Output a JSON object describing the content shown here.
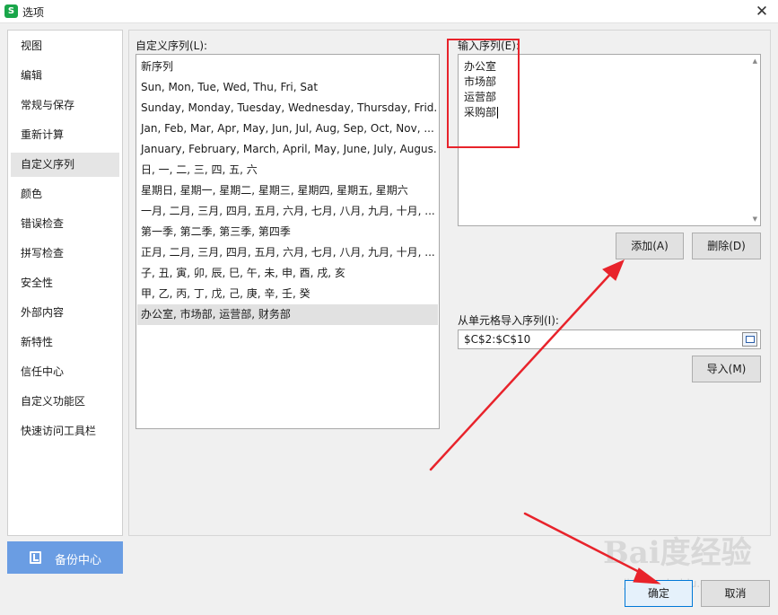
{
  "window": {
    "title": "选项",
    "app_icon_letter": "S"
  },
  "nav": {
    "items": [
      {
        "label": "视图",
        "active": false
      },
      {
        "label": "编辑",
        "active": false
      },
      {
        "label": "常规与保存",
        "active": false
      },
      {
        "label": "重新计算",
        "active": false
      },
      {
        "label": "自定义序列",
        "active": true
      },
      {
        "label": "颜色",
        "active": false
      },
      {
        "label": "错误检查",
        "active": false
      },
      {
        "label": "拼写检查",
        "active": false
      },
      {
        "label": "安全性",
        "active": false
      },
      {
        "label": "外部内容",
        "active": false
      },
      {
        "label": "新特性",
        "active": false
      },
      {
        "label": "信任中心",
        "active": false
      },
      {
        "label": "自定义功能区",
        "active": false
      },
      {
        "label": "快速访问工具栏",
        "active": false
      }
    ],
    "backup_label": "备份中心"
  },
  "custom_lists": {
    "label": "自定义序列(L):",
    "items": [
      {
        "text": "新序列",
        "selected": false
      },
      {
        "text": "Sun, Mon, Tue, Wed, Thu, Fri, Sat",
        "selected": false
      },
      {
        "text": "Sunday, Monday, Tuesday, Wednesday, Thursday, Frid...",
        "selected": false
      },
      {
        "text": "Jan, Feb, Mar, Apr, May, Jun, Jul, Aug, Sep, Oct, Nov, ...",
        "selected": false
      },
      {
        "text": "January, February, March, April, May, June, July, Augus...",
        "selected": false
      },
      {
        "text": "日, 一, 二, 三, 四, 五, 六",
        "selected": false
      },
      {
        "text": "星期日, 星期一, 星期二, 星期三, 星期四, 星期五, 星期六",
        "selected": false
      },
      {
        "text": "一月, 二月, 三月, 四月, 五月, 六月, 七月, 八月, 九月, 十月, ...",
        "selected": false
      },
      {
        "text": "第一季, 第二季, 第三季, 第四季",
        "selected": false
      },
      {
        "text": "正月, 二月, 三月, 四月, 五月, 六月, 七月, 八月, 九月, 十月, ...",
        "selected": false
      },
      {
        "text": "子, 丑, 寅, 卯, 辰, 巳, 午, 未, 申, 酉, 戌, 亥",
        "selected": false
      },
      {
        "text": "甲, 乙, 丙, 丁, 戊, 己, 庚, 辛, 壬, 癸",
        "selected": false
      },
      {
        "text": "办公室, 市场部, 运营部, 财务部",
        "selected": true
      }
    ]
  },
  "entries": {
    "label": "输入序列(E):",
    "lines": [
      "办公室",
      "市场部",
      "运营部",
      "采购部"
    ]
  },
  "buttons": {
    "add": "添加(A)",
    "delete": "删除(D)",
    "import": "导入(M)",
    "ok": "确定",
    "cancel": "取消"
  },
  "import_range": {
    "label": "从单元格导入序列(I):",
    "value": "$C$2:$C$10"
  },
  "annotation_color": "#e8232b",
  "watermark": {
    "main": "Bai度经验",
    "sub": "jingyan.baidu.com"
  }
}
